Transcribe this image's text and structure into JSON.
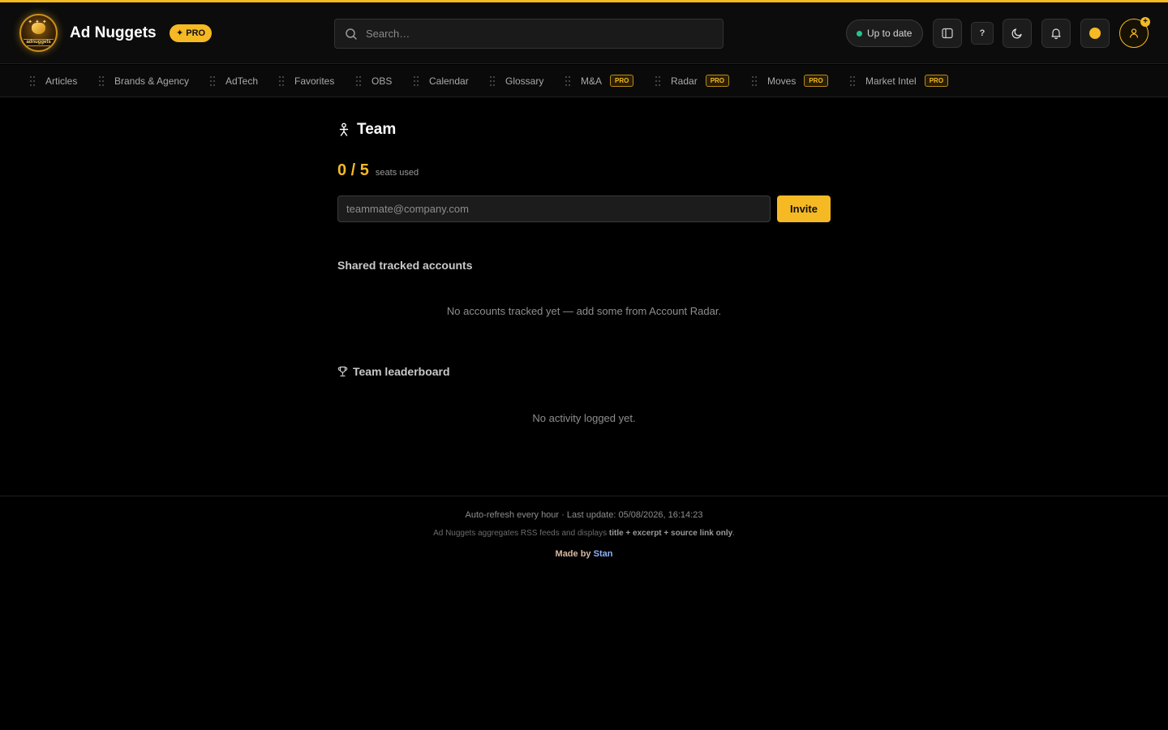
{
  "header": {
    "brand_name": "Ad Nuggets",
    "logo_text": "adnuggets",
    "pro_label": "✦ PRO",
    "search_placeholder": "Search…",
    "status_label": "Up to date",
    "help_label": "?",
    "avatar_badge": "+"
  },
  "nav": {
    "items": [
      {
        "label": "Articles",
        "pro": ""
      },
      {
        "label": "Brands & Agency",
        "pro": ""
      },
      {
        "label": "AdTech",
        "pro": ""
      },
      {
        "label": "Favorites",
        "pro": ""
      },
      {
        "label": "OBS",
        "pro": ""
      },
      {
        "label": "Calendar",
        "pro": ""
      },
      {
        "label": "Glossary",
        "pro": ""
      },
      {
        "label": "M&A",
        "pro": "PRO"
      },
      {
        "label": "Radar",
        "pro": "PRO"
      },
      {
        "label": "Moves",
        "pro": "PRO"
      },
      {
        "label": "Market Intel",
        "pro": "PRO"
      }
    ]
  },
  "team": {
    "title": "Team",
    "seats_count": "0 / 5",
    "seats_label": "seats used",
    "invite_placeholder": "teammate@company.com",
    "invite_label": "Invite",
    "shared_heading": "Shared tracked accounts",
    "shared_empty": "No accounts tracked yet — add some from Account Radar.",
    "leaderboard_heading": "Team leaderboard",
    "leaderboard_empty": "No activity logged yet."
  },
  "footer": {
    "refresh_line": "Auto-refresh every hour · Last update: 05/08/2026, 16:14:23",
    "disclaimer_prefix": "Ad Nuggets aggregates RSS feeds and displays ",
    "disclaimer_bold": "title + excerpt + source link only",
    "disclaimer_suffix": ".",
    "made_by": "Made by ",
    "author": "Stan"
  },
  "colors": {
    "accent": "#f5b924",
    "status_ok": "#22c58b",
    "background": "#000000"
  }
}
